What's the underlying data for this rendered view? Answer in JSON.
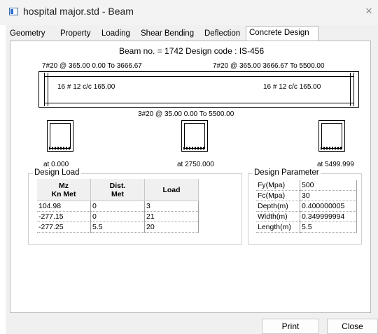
{
  "window": {
    "title": "hospital major.std - Beam",
    "close_glyph": "×",
    "icon": "app-window-icon"
  },
  "tabs": [
    {
      "label": "Geometry"
    },
    {
      "label": "Property"
    },
    {
      "label": "Loading"
    },
    {
      "label": "Shear Bending"
    },
    {
      "label": "Deflection"
    },
    {
      "label": "Concrete Design",
      "active": true
    }
  ],
  "beam": {
    "info": "Beam no. = 1742  Design code :  IS-456",
    "top_left_rebar": "7#20 @ 365.00 0.00 To 3666.67",
    "top_right_rebar": "7#20 @ 365.00 3666.67 To 5500.00",
    "stirrup_left": "16 # 12 c/c 165.00",
    "stirrup_right": "16 # 12 c/c 165.00",
    "bottom_rebar": "3#20 @ 35.00 0.00 To 5500.00",
    "sections": [
      {
        "label": "at 0.000"
      },
      {
        "label": "at 2750.000"
      },
      {
        "label": "at 5499.999"
      }
    ]
  },
  "design_load": {
    "title": "Design Load",
    "headers": [
      "Mz\nKn Met",
      "Dist.\nMet",
      "Load"
    ],
    "rows": [
      [
        "104.98",
        "0",
        "3"
      ],
      [
        "-277.15",
        "0",
        "21"
      ],
      [
        "-277.25",
        "5.5",
        "20"
      ]
    ]
  },
  "design_parameter": {
    "title": "Design Parameter",
    "rows": [
      [
        "Fy(Mpa)",
        "500"
      ],
      [
        "Fc(Mpa)",
        "30"
      ],
      [
        "Depth(m)",
        "0.400000005"
      ],
      [
        "Width(m)",
        "0.349999994"
      ],
      [
        "Length(m)",
        "5.5"
      ]
    ]
  },
  "buttons": {
    "print": "Print",
    "close": "Close"
  }
}
